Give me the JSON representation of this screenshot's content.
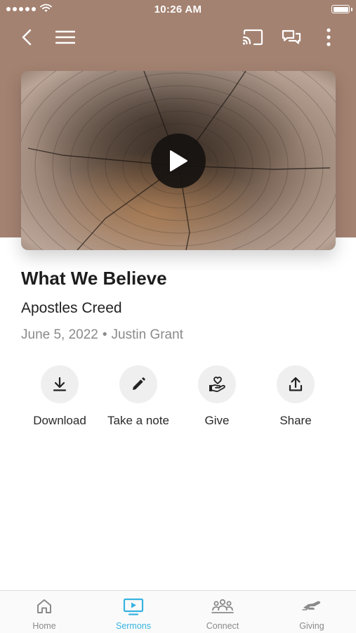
{
  "status_bar": {
    "time": "10:26 AM"
  },
  "sermon": {
    "title": "What We Believe",
    "subtitle": "Apostles Creed",
    "date": "June 5, 2022",
    "separator": "•",
    "speaker": "Justin Grant"
  },
  "actions": [
    {
      "label": "Download",
      "icon": "download-icon"
    },
    {
      "label": "Take a note",
      "icon": "pencil-icon"
    },
    {
      "label": "Give",
      "icon": "hand-heart-icon"
    },
    {
      "label": "Share",
      "icon": "share-icon"
    }
  ],
  "tabs": [
    {
      "label": "Home",
      "icon": "home-icon",
      "active": false
    },
    {
      "label": "Sermons",
      "icon": "tv-play-icon",
      "active": true
    },
    {
      "label": "Connect",
      "icon": "people-icon",
      "active": false
    },
    {
      "label": "Giving",
      "icon": "handshake-icon",
      "active": false
    }
  ],
  "colors": {
    "header_background": "#a48271",
    "active_tab": "#37b3e0",
    "inactive_tab": "#8a8a8a",
    "action_circle": "#efefef"
  }
}
